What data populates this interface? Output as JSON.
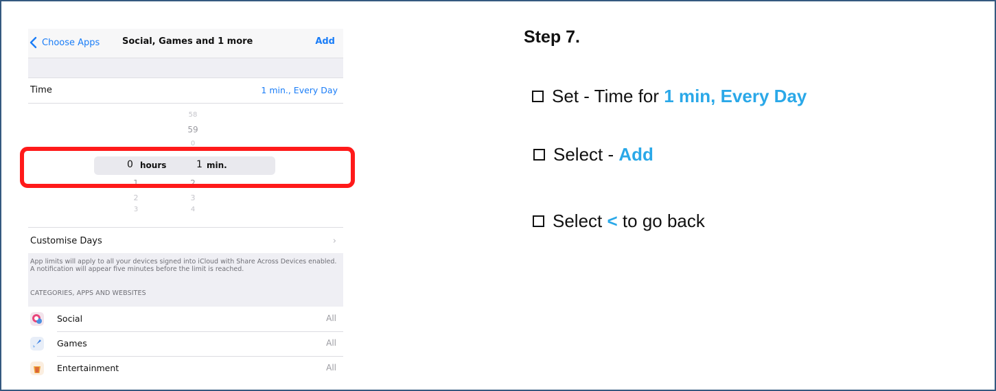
{
  "colors": {
    "accent": "#2aa8e8",
    "ios_blue": "#1a7df7",
    "highlight_box": "#ff1a1a",
    "frame_border": "#34587f"
  },
  "phone": {
    "nav": {
      "back_label": "Choose Apps",
      "title": "Social, Games and 1 more",
      "add_label": "Add"
    },
    "time_row": {
      "label": "Time",
      "value": "1 min., Every Day"
    },
    "picker": {
      "hours_above": [
        "",
        "",
        ""
      ],
      "minutes_above": [
        "58",
        "59",
        "0"
      ],
      "selected_hours": "0",
      "hours_unit": "hours",
      "selected_minutes": "1",
      "minutes_unit": "min.",
      "hours_below": [
        "1",
        "2",
        "3"
      ],
      "minutes_below": [
        "2",
        "3",
        "4"
      ]
    },
    "customise_days": {
      "label": "Customise Days",
      "chevron": "›"
    },
    "info_text": "App limits will apply to all your devices signed into iCloud with Share Across Devices enabled. A notification will appear five minutes before the limit is reached.",
    "section_header": "CATEGORIES, APPS AND WEBSITES",
    "apps": [
      {
        "name": "Social",
        "value": "All",
        "icon": "social-icon"
      },
      {
        "name": "Games",
        "value": "All",
        "icon": "games-icon"
      },
      {
        "name": "Entertainment",
        "value": "All",
        "icon": "entertainment-icon"
      }
    ]
  },
  "instructions": {
    "step_title": "Step 7.",
    "items": [
      {
        "prefix": "Set - Time for ",
        "highlight": "1 min, Every Day",
        "suffix": ""
      },
      {
        "prefix": "Select - ",
        "highlight": "Add",
        "suffix": ""
      },
      {
        "prefix": "Select ",
        "highlight": "<",
        "suffix": " to go back"
      }
    ]
  }
}
